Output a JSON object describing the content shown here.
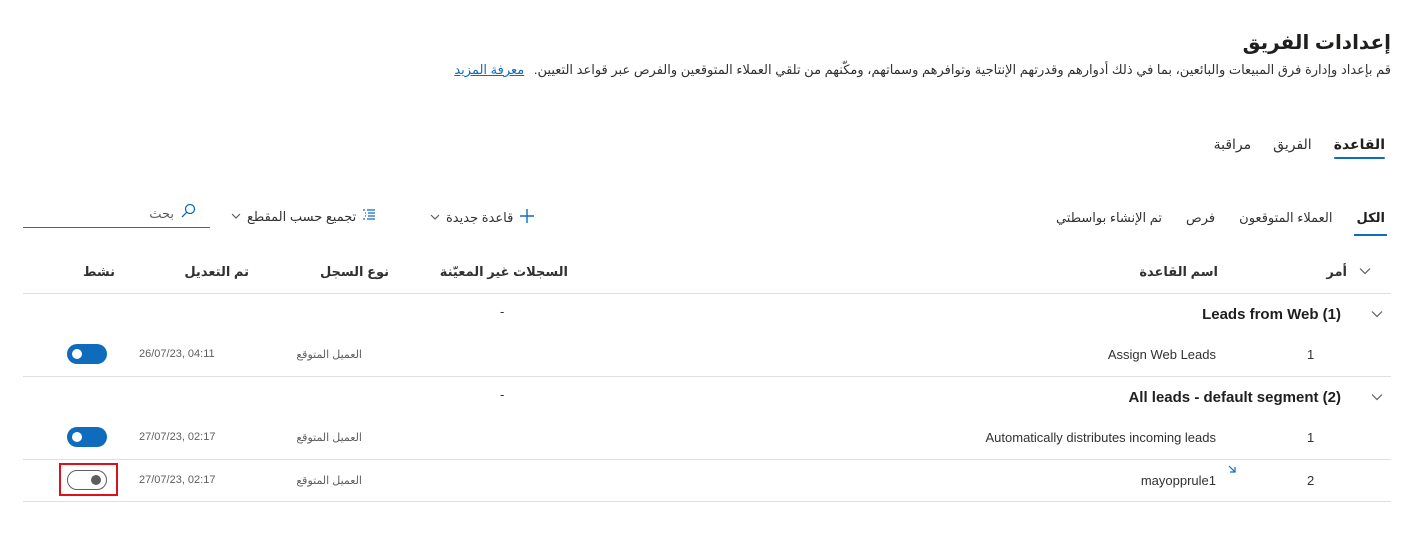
{
  "header": {
    "title": "إعدادات الفريق",
    "description": "قم بإعداد وإدارة فرق المبيعات والبائعين، بما في ذلك أدوارهم وقدرتهم الإنتاجية وتوافرهم وسماتهم، ومكّنهم من تلقي العملاء المتوقعين والفرص عبر قواعد التعيين.",
    "learn_more": "معرفة المزيد"
  },
  "main_tabs": [
    {
      "label": "القاعدة",
      "active": true
    },
    {
      "label": "الفريق",
      "active": false
    },
    {
      "label": "مراقبة",
      "active": false
    }
  ],
  "filter_tabs": [
    {
      "label": "الكل",
      "active": true
    },
    {
      "label": "العملاء المتوقعون",
      "active": false
    },
    {
      "label": "فرص",
      "active": false
    },
    {
      "label": "تم الإنشاء بواسطتي",
      "active": false
    }
  ],
  "toolbar": {
    "new_rule": "قاعدة جديدة",
    "group_by": "تجميع حسب المقطع",
    "search_placeholder": "بحث"
  },
  "table": {
    "headers": {
      "order": "أمر",
      "rule_name": "اسم القاعدة",
      "unassigned": "السجلات غير المعيّنة",
      "record_type": "نوع السجل",
      "modified": "تم التعديل",
      "active": "نشط"
    },
    "groups": [
      {
        "title": "Leads from Web (1)",
        "unassigned": "-",
        "rows": [
          {
            "order": "1",
            "name": "Assign Web Leads",
            "record_type": "العميل المتوقع",
            "modified": "26/07/23, 04:11",
            "active": true
          }
        ]
      },
      {
        "title": "All leads - default segment (2)",
        "unassigned": "-",
        "rows": [
          {
            "order": "1",
            "name": "Automatically distributes incoming leads",
            "record_type": "العميل المتوقع",
            "modified": "27/07/23, 02:17",
            "active": true
          },
          {
            "order": "2",
            "name": "mayopprule1",
            "record_type": "العميل المتوقع",
            "modified": "27/07/23, 02:17",
            "active": false
          }
        ]
      }
    ]
  },
  "colors": {
    "accent": "#0f6cbd",
    "highlight": "#e0101a"
  }
}
